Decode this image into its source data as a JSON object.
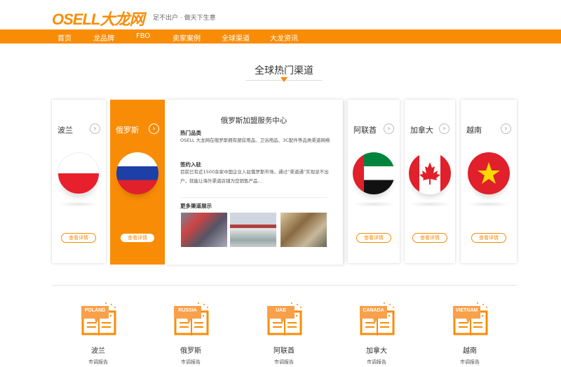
{
  "header": {
    "logo": "OSELL大龙网",
    "slogan": "足不出户 · 做天下生意"
  },
  "nav": [
    "首页",
    "龙品牌",
    "FBO",
    "卖家案例",
    "全球渠道",
    "大龙资讯"
  ],
  "section_title": "全球热门渠道",
  "details_label": "查看详情",
  "cards": [
    {
      "name": "波兰"
    },
    {
      "name": "俄罗斯"
    },
    {
      "name": "阿联酋"
    },
    {
      "name": "加拿大"
    },
    {
      "name": "越南"
    }
  ],
  "expanded": {
    "title": "俄罗斯加盟服务中心",
    "h1": "热门品类",
    "p1": "OSELL 大龙网在俄罗斯拥有厨房用品、卫浴用品、3C配件等品类渠道网络",
    "h2": "签约入驻",
    "p2": "目前已有近1500余家中国企业入驻俄罗斯市场，通过“渠道通”实现足不出户，就能让海外渠道店铺为您销售产品...",
    "h3": "更多渠道展示"
  },
  "reports": [
    {
      "tag": "POLAND",
      "name": "波兰",
      "sub": "市调报告"
    },
    {
      "tag": "RUSSIA",
      "name": "俄罗斯",
      "sub": "市调报告"
    },
    {
      "tag": "UAE",
      "name": "阿联酋",
      "sub": "市调报告"
    },
    {
      "tag": "CANADA",
      "name": "加拿大",
      "sub": "市调报告"
    },
    {
      "tag": "VIETNAM",
      "name": "越南",
      "sub": "市调报告"
    }
  ],
  "colors": {
    "accent": "#f98c06"
  }
}
